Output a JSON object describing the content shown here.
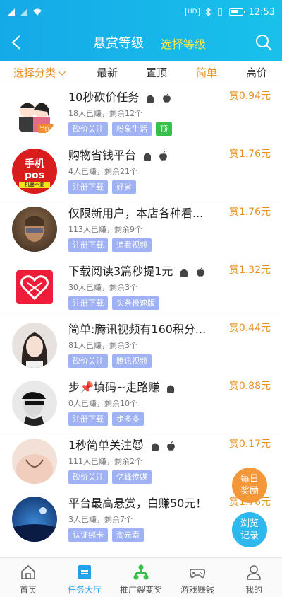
{
  "status": {
    "time": "12:53",
    "hd": "HD"
  },
  "header": {
    "title": "悬赏等级",
    "select_label": "选择等级"
  },
  "filters": {
    "category": "选择分类",
    "latest": "最新",
    "pinned": "置顶",
    "simple": "简单",
    "high_price": "高价"
  },
  "tasks": [
    {
      "title": "10秒砍价任务",
      "reward": "赏0.94元",
      "meta": "18人已赚，剩余12个",
      "tags": [
        "砍价关注",
        "粉象生活",
        "顶"
      ],
      "avatar_text": "半价"
    },
    {
      "title": "购物省钱平台",
      "reward": "赏1.76元",
      "meta": "4人已赚，剩余21个",
      "tags": [
        "注册下载",
        "好省"
      ],
      "avatar_text": "手机pos",
      "avatar_sub": "机器不要"
    },
    {
      "title": "仅限新用户，本店各种看...",
      "reward": "赏1.76元",
      "meta": "113人已赚，剩余9个",
      "tags": [
        "注册下载",
        "追看视频"
      ]
    },
    {
      "title": "下载阅读3篇秒提1元",
      "reward": "赏1.32元",
      "meta": "30人已赚，剩余3个",
      "tags": [
        "注册下载",
        "头条极速版"
      ]
    },
    {
      "title": "简单:腾讯视频有160积分...",
      "reward": "赏0.44元",
      "meta": "81人已赚，剩余3个",
      "tags": [
        "砍价关注",
        "腾讯视频"
      ]
    },
    {
      "title": "步📌填码~走路赚",
      "reward": "赏0.88元",
      "meta": "0人已赚，剩余10个",
      "tags": [
        "注册下载",
        "步多多"
      ]
    },
    {
      "title": "1秒简单关注😈",
      "reward": "赏0.17元",
      "meta": "111人已赚，剩余2个",
      "tags": [
        "砍价关注",
        "亿峰传媒"
      ]
    },
    {
      "title": "平台最高悬赏，白赚50元！",
      "reward": "赏1.76元",
      "meta": "3人已赚，剩余7个",
      "tags": [
        "认证绑卡",
        "淘元素"
      ]
    }
  ],
  "floating": {
    "daily": "每日奖励",
    "browse": "浏览记录"
  },
  "tabbar": [
    {
      "label": "首页",
      "icon": "home-icon"
    },
    {
      "label": "任务大厅",
      "icon": "task-hall-icon"
    },
    {
      "label": "推广裂变奖",
      "icon": "referral-tree-icon"
    },
    {
      "label": "游戏赚钱",
      "icon": "gamepad-icon"
    },
    {
      "label": "我的",
      "icon": "user-icon"
    }
  ],
  "colors": {
    "primary": "#15a9e8",
    "accent": "#e69122",
    "tag": "#9fb2f3",
    "pinned_tag": "#36c24a",
    "select": "#f4e64a"
  }
}
